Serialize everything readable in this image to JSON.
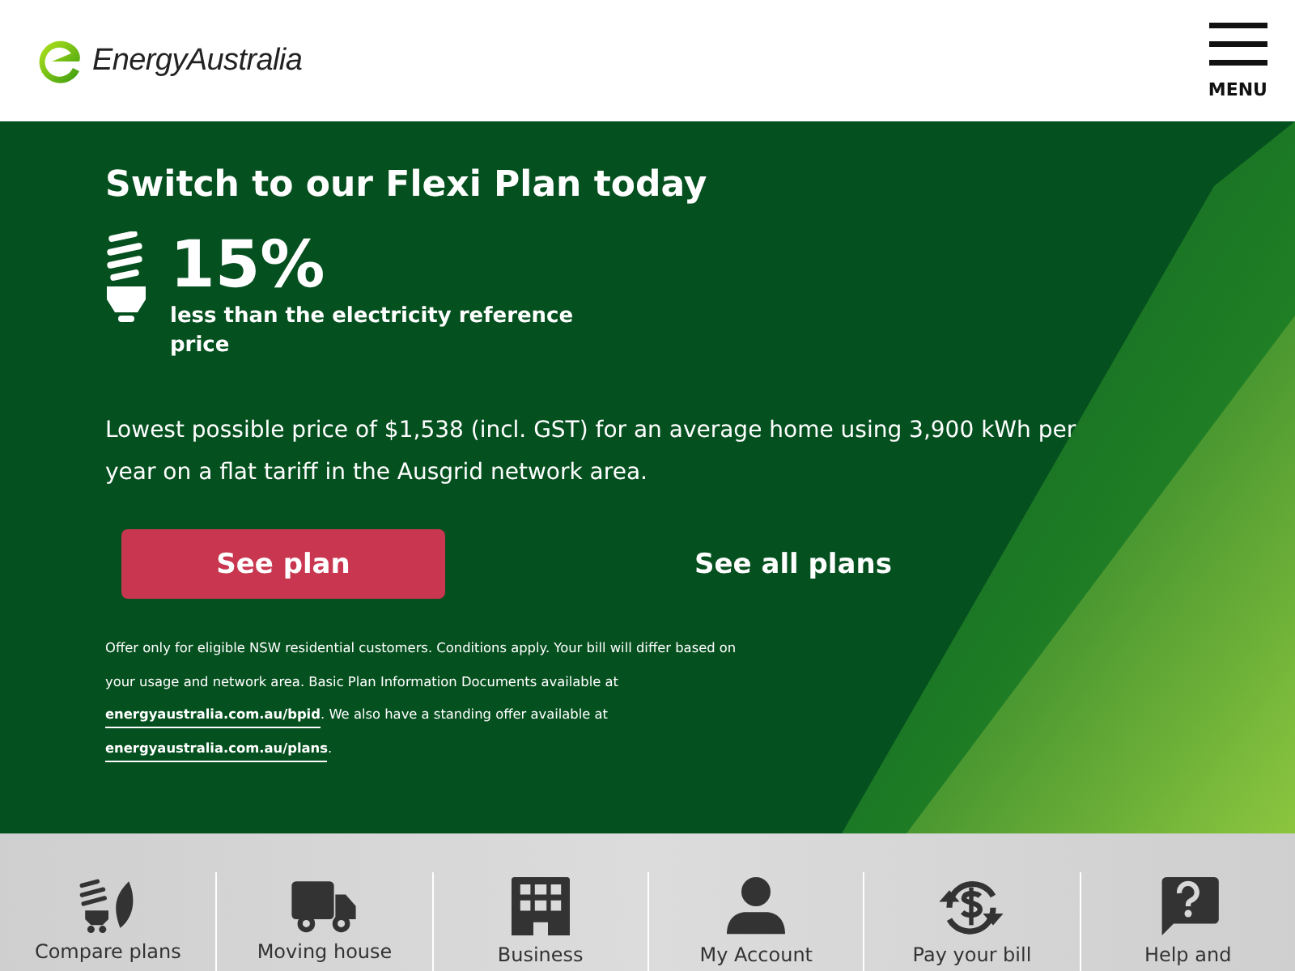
{
  "header": {
    "logo_text": "EnergyAustralia",
    "menu_label": "MENU"
  },
  "hero": {
    "title": "Switch to our Flexi Plan today",
    "discount": "15%",
    "discount_caption": "less than the electricity reference price",
    "description": "Lowest possible price of $1,538 (incl. GST) for an average home using 3,900 kWh per year on a flat tariff in the Ausgrid network area.",
    "primary_button": "See plan",
    "secondary_button": "See all plans",
    "fine_print": [
      {
        "kind": "text",
        "text": "Offer only for eligible NSW residential customers. Conditions apply. Your bill will differ based on your usage and network area. Basic Plan Information Documents available at "
      },
      {
        "kind": "link",
        "text": "energyaustralia.com.au/bpid"
      },
      {
        "kind": "text",
        "text": ". We also have a standing offer available at "
      },
      {
        "kind": "link",
        "text": "energyaustralia.com.au/plans"
      },
      {
        "kind": "text",
        "text": "."
      }
    ]
  },
  "quick_links": [
    {
      "kind": "bulb",
      "label": "Compare plans"
    },
    {
      "kind": "truck",
      "label": "Moving house"
    },
    {
      "kind": "building",
      "label": "Business"
    },
    {
      "kind": "user",
      "label": "My Account"
    },
    {
      "kind": "pay",
      "label": "Pay your bill"
    },
    {
      "kind": "help",
      "label": "Help and"
    }
  ]
}
